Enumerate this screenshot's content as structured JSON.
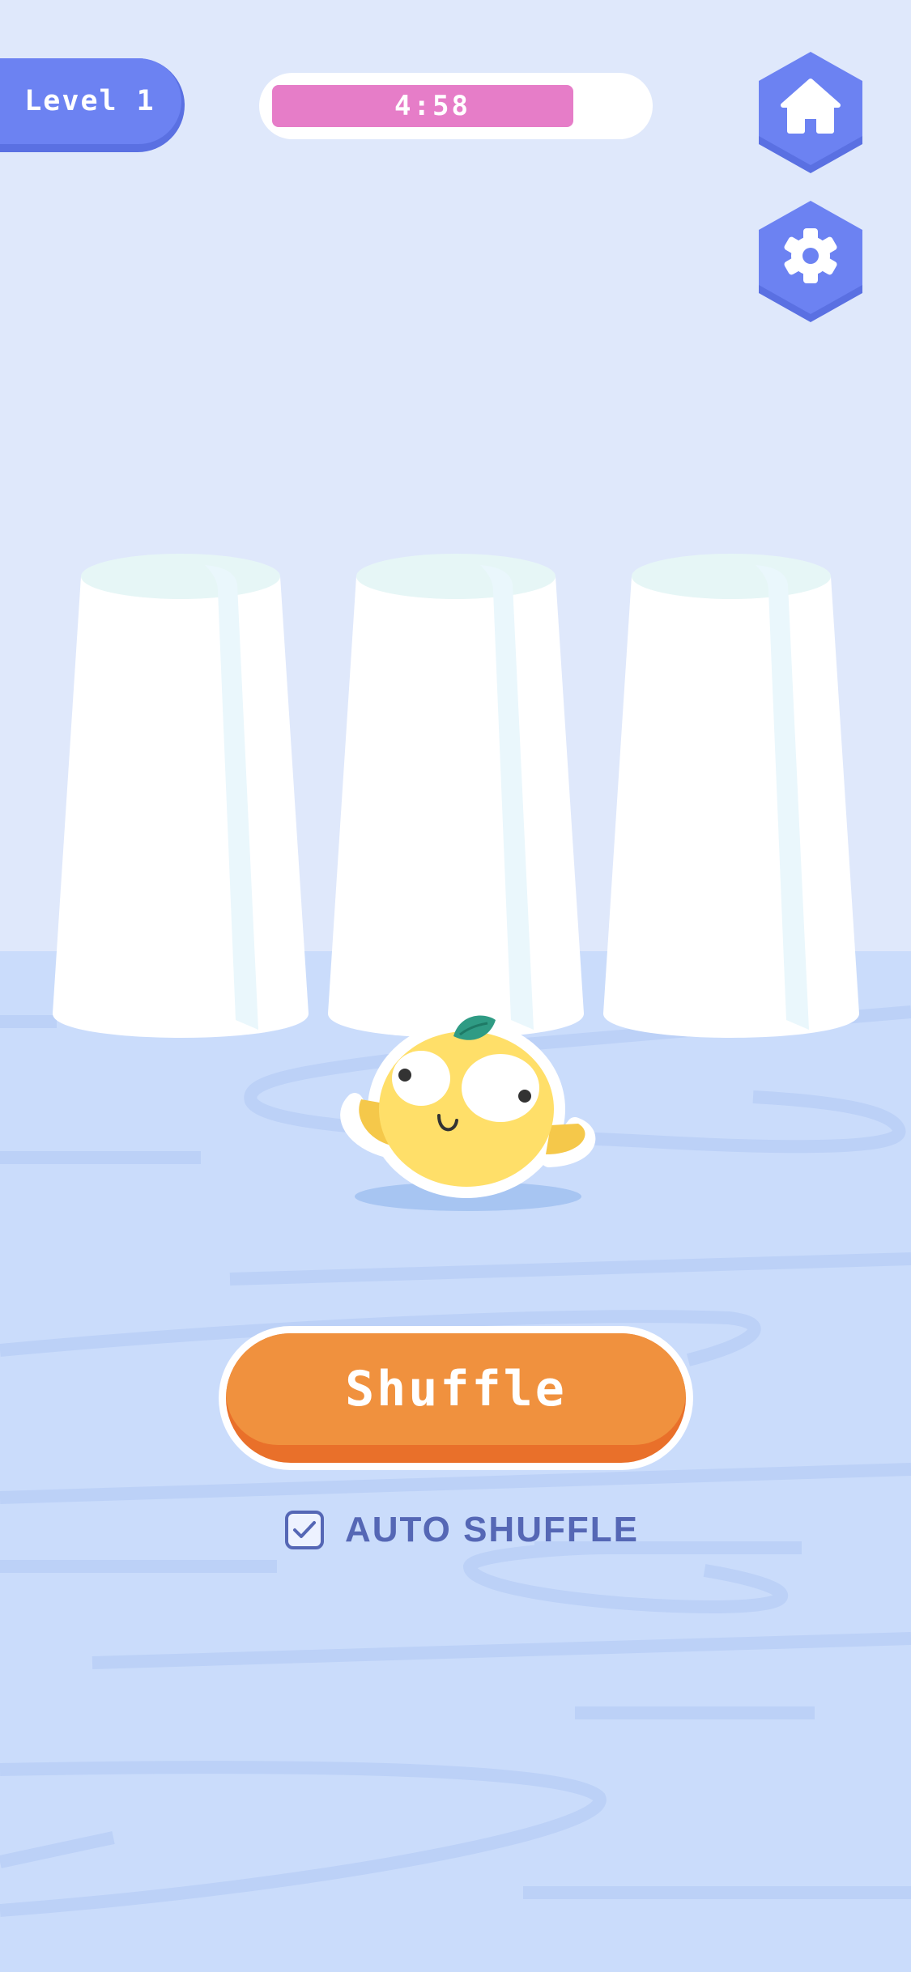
{
  "hud": {
    "level_label": "Level 1",
    "timer_text": "4:58",
    "timer_fraction": 0.82,
    "home_icon": "home-icon",
    "settings_icon": "gear-icon"
  },
  "game": {
    "cups": [
      "cup-1",
      "cup-2",
      "cup-3"
    ],
    "character": "lemon-character"
  },
  "controls": {
    "shuffle_label": "Shuffle",
    "auto_shuffle_label": "AUTO SHUFFLE",
    "auto_shuffle_checked": true
  },
  "colors": {
    "accent": "#6C82F2",
    "timer": "#E67DC8",
    "button": "#F0913E",
    "background": "#DFE8FB",
    "floor": "#CADCFB"
  }
}
